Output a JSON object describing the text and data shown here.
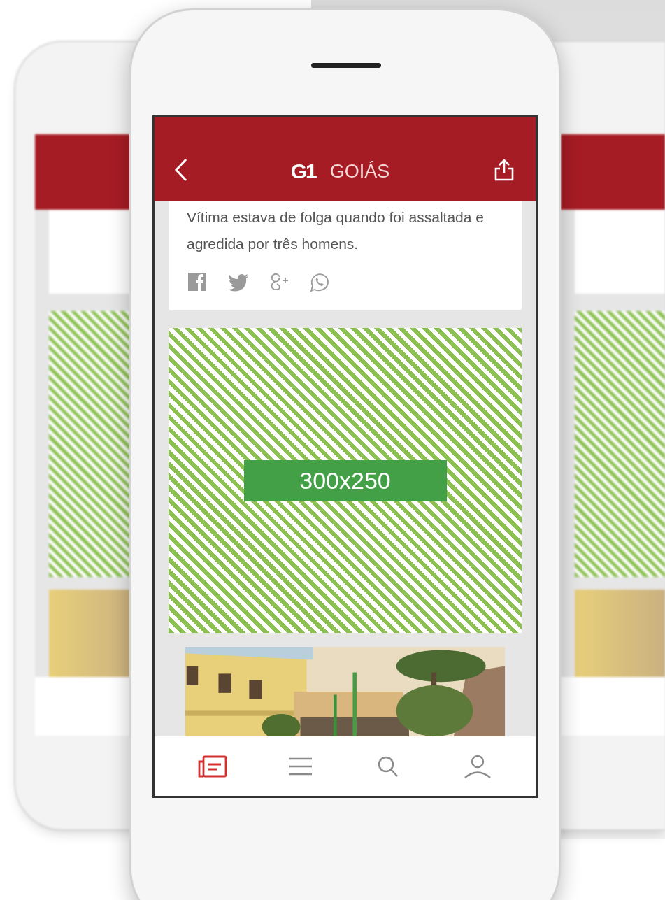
{
  "header": {
    "logo": "G1",
    "title": "GOIÁS"
  },
  "article": {
    "summary": "Vítima estava de folga quando foi assaltada e agredida por três homens.",
    "share": [
      {
        "kind": "facebook"
      },
      {
        "kind": "twitter"
      },
      {
        "kind": "googleplus"
      },
      {
        "kind": "whatsapp"
      }
    ]
  },
  "ad": {
    "label": "300x250"
  },
  "tab_bar": [
    {
      "kind": "news",
      "selected": true
    },
    {
      "kind": "menu",
      "selected": false
    },
    {
      "kind": "search",
      "selected": false
    },
    {
      "kind": "profile",
      "selected": false
    }
  ]
}
